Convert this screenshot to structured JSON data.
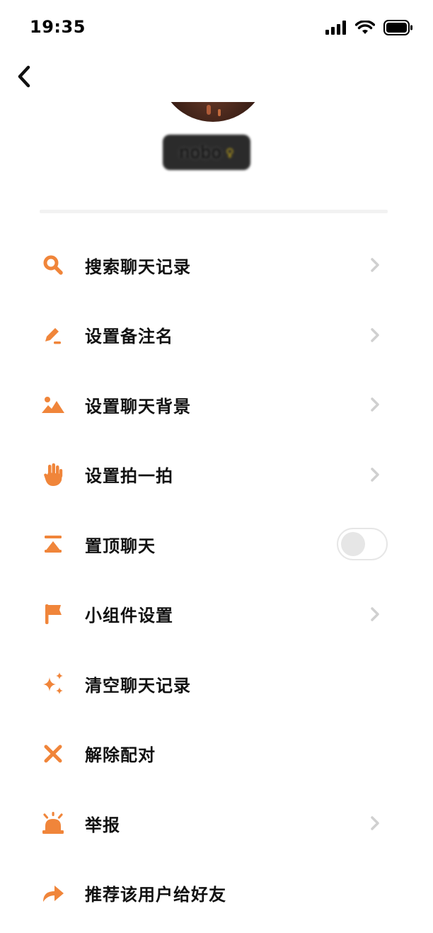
{
  "status_bar": {
    "time": "19:35"
  },
  "header": {
    "back_icon": "chevron-left-icon"
  },
  "profile": {
    "username": "nobo",
    "gender_symbol": "♀"
  },
  "colors": {
    "accent": "#F0853A",
    "chevron": "#D0D0D0",
    "toggle_track": "#E6E6E6",
    "divider": "#F2F2F2"
  },
  "menu": {
    "items": [
      {
        "label": "搜索聊天记录",
        "icon": "search-icon",
        "trailing": "chevron"
      },
      {
        "label": "设置备注名",
        "icon": "pencil-icon",
        "trailing": "chevron"
      },
      {
        "label": "设置聊天背景",
        "icon": "landscape-icon",
        "trailing": "chevron"
      },
      {
        "label": "设置拍一拍",
        "icon": "hand-icon",
        "trailing": "chevron"
      },
      {
        "label": "置顶聊天",
        "icon": "pin-top-icon",
        "trailing": "toggle",
        "toggle_on": false
      },
      {
        "label": "小组件设置",
        "icon": "flag-icon",
        "trailing": "chevron"
      },
      {
        "label": "清空聊天记录",
        "icon": "sparkle-icon",
        "trailing": "none"
      },
      {
        "label": "解除配对",
        "icon": "close-icon",
        "trailing": "none"
      },
      {
        "label": "举报",
        "icon": "alarm-icon",
        "trailing": "chevron"
      },
      {
        "label": "推荐该用户给好友",
        "icon": "share-arrow-icon",
        "trailing": "none"
      }
    ]
  }
}
